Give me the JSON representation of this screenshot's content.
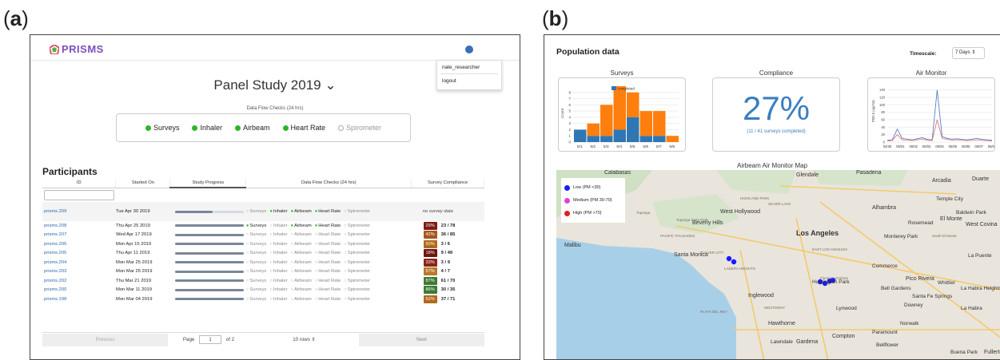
{
  "panel_labels": {
    "a": "a",
    "b": "b"
  },
  "app": {
    "logo_text": "PRISMS",
    "user_menu": {
      "username": "nate_researcher",
      "logout": "logout"
    },
    "study_title": "Panel Study 2019 ⌄",
    "checks_caption": "Data Flow Checks (24 hrs)",
    "checks": [
      {
        "label": "Surveys",
        "status": "on"
      },
      {
        "label": "Inhaler",
        "status": "on"
      },
      {
        "label": "Airbeam",
        "status": "on"
      },
      {
        "label": "Heart Rate",
        "status": "on"
      },
      {
        "label": "Spirometer",
        "status": "off"
      }
    ],
    "participants_heading": "Participants",
    "columns": [
      "ID",
      "Started On",
      "Study Progress",
      "Data Flow Checks (24 hrs)",
      "Survey Compliance"
    ],
    "flow_labels": [
      "Surveys",
      "Inhaler",
      "Airbeam",
      "Heart Rate",
      "Spirometer"
    ],
    "rows": [
      {
        "id": "prisms.209",
        "started": "Tue Apr 30 2019",
        "progress": 0.55,
        "flows": [
          0,
          1,
          1,
          1,
          0
        ],
        "compliance_pct": null,
        "compliance_text": "no survey data",
        "counts": ""
      },
      {
        "id": "prisms.208",
        "started": "Thu Apr 25 2019",
        "progress": 1,
        "flows": [
          1,
          0,
          1,
          1,
          0
        ],
        "compliance_pct": "29%",
        "color": "#7b1c13",
        "counts": "23 / 78"
      },
      {
        "id": "prisms.207",
        "started": "Wed Apr 17 2019",
        "progress": 1,
        "flows": [
          0,
          0,
          0,
          0,
          0
        ],
        "compliance_pct": "42%",
        "color": "#a9561c",
        "counts": "36 / 85"
      },
      {
        "id": "prisms.206",
        "started": "Mon Apr 15 2019",
        "progress": 1,
        "flows": [
          0,
          0,
          0,
          0,
          0
        ],
        "compliance_pct": "50%",
        "color": "#b06a1c",
        "counts": "3 / 6"
      },
      {
        "id": "prisms.205",
        "started": "Thu Apr 11 2019",
        "progress": 1,
        "flows": [
          0,
          0,
          0,
          0,
          0
        ],
        "compliance_pct": "18%",
        "color": "#6e160f",
        "counts": "9 / 49"
      },
      {
        "id": "prisms.204",
        "started": "Mon Mar 25 2019",
        "progress": 1,
        "flows": [
          0,
          0,
          0,
          0,
          0
        ],
        "compliance_pct": "33%",
        "color": "#8a2617",
        "counts": "3 / 9"
      },
      {
        "id": "prisms.203",
        "started": "Mon Mar 25 2019",
        "progress": 1,
        "flows": [
          0,
          0,
          0,
          0,
          0
        ],
        "compliance_pct": "57%",
        "color": "#b9782a",
        "counts": "4 / 7"
      },
      {
        "id": "prisms.202",
        "started": "Thu Mar 21 2019",
        "progress": 1,
        "flows": [
          0,
          0,
          0,
          0,
          0
        ],
        "compliance_pct": "87%",
        "color": "#3d7a35",
        "counts": "61 / 70"
      },
      {
        "id": "prisms.200",
        "started": "Mon Mar 11 2019",
        "progress": 1,
        "flows": [
          0,
          0,
          0,
          0,
          0
        ],
        "compliance_pct": "86%",
        "color": "#3d7a35",
        "counts": "30 / 35"
      },
      {
        "id": "prisms.198",
        "started": "Mon Mar 04 2019",
        "progress": 1,
        "flows": [
          0,
          0,
          0,
          0,
          0
        ],
        "compliance_pct": "52%",
        "color": "#b06a1c",
        "counts": "37 / 71"
      }
    ],
    "pager": {
      "previous": "Previous",
      "page_label": "Page",
      "page_value": "1",
      "of_label": "of 2",
      "rows_select": "10 rows ⇕",
      "next": "Next"
    }
  },
  "dashboard": {
    "title": "Population data",
    "timescale_label": "Timescale:",
    "timescale_value": "7 Days ⇕",
    "surveys_title": "Surveys",
    "compliance_title": "Compliance",
    "compliance_value": "27%",
    "compliance_sub": "(11 / 41 surveys completed)",
    "air_title": "Air Monitor",
    "map_title": "Airbeam Air Monitor Map",
    "legend": [
      {
        "label": "Low (PM <30)",
        "color": "#1a1aff"
      },
      {
        "label": "Medium (PM 30-70)",
        "color": "#e040e0"
      },
      {
        "label": "High (PM >70)",
        "color": "#e02020"
      }
    ],
    "places": [
      "Calabasas",
      "Glendale",
      "Pasadena",
      "Arcadia",
      "Duarte",
      "Temple City",
      "Baldwin Park",
      "West Hollywood",
      "Beverly Hills",
      "Alhambra",
      "Rosemead",
      "El Monte",
      "West Covina",
      "Monterey Park",
      "South El Monte",
      "Los Angeles",
      "Malibu",
      "Santa Monica",
      "La Puente",
      "Commerce",
      "Pico Rivera",
      "Whittier",
      "La Habra Heights",
      "Huntington Park",
      "Bell Gardens",
      "Santa Fe Springs",
      "Inglewood",
      "Downey",
      "La Habra",
      "Lynwood",
      "Norwalk",
      "Hawthorne",
      "Compton",
      "Paramount",
      "Gardena",
      "Lawndale",
      "Bellflower",
      "Buena Park",
      "Fullerton",
      "Florence-Graham",
      "Topanga",
      "Topanga State Park",
      "PACIFIC PALISADES",
      "CULVER CITY",
      "LADERA HEIGHTS",
      "EAST LOS ANGELES",
      "WESTMONT",
      "PLAYA DEL REY",
      "HIGHLAND PARK",
      "SILVER LAKE"
    ]
  },
  "chart_data": [
    {
      "type": "bar",
      "title": "Surveys",
      "ylabel": "Count",
      "categories": [
        "5/1",
        "5/2",
        "5/3",
        "5/4",
        "5/5",
        "5/6",
        "5/7",
        "5/8"
      ],
      "series": [
        {
          "name": "completed",
          "color": "#2f77b4",
          "values": [
            2,
            1,
            1,
            2,
            4,
            1,
            1,
            0
          ]
        },
        {
          "name": "",
          "color": "#ff7f0e",
          "values": [
            0,
            2,
            5,
            7,
            4,
            4,
            4,
            1
          ]
        }
      ],
      "ylim": [
        0,
        9
      ],
      "yticks": [
        0,
        1,
        2,
        3,
        4,
        5,
        6,
        7,
        8
      ]
    },
    {
      "type": "line",
      "title": "Air Monitor",
      "ylabel": "PM2.5 (ug/m3)",
      "x": [
        "04/30",
        "05/01",
        "05/02",
        "05/03",
        "05/04",
        "05/05",
        "05/06",
        "05/07",
        "05/08"
      ],
      "ylim": [
        0,
        150
      ],
      "yticks": [
        0,
        20,
        40,
        60,
        80,
        100,
        120,
        140
      ],
      "series": [
        {
          "name": "",
          "color": "#5b7fc7",
          "values": [
            5,
            6,
            35,
            10,
            8,
            6,
            9,
            12,
            7,
            6,
            140,
            15,
            10,
            8,
            9,
            7,
            6,
            8,
            10,
            7,
            6,
            5
          ]
        },
        {
          "name": "",
          "color": "#e07a7a",
          "values": [
            3,
            4,
            20,
            6,
            5,
            4,
            6,
            8,
            5,
            4,
            60,
            10,
            7,
            5,
            6,
            5,
            4,
            5,
            6,
            5,
            4,
            3
          ]
        }
      ]
    }
  ]
}
